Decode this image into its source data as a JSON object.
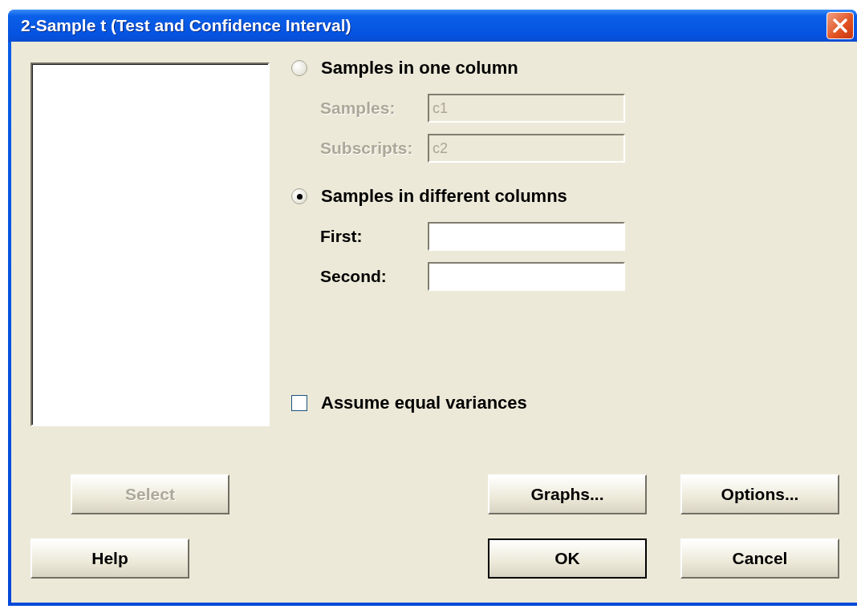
{
  "window": {
    "title": "2-Sample t (Test and Confidence Interval)"
  },
  "modes": [
    {
      "label": "Samples in one column",
      "selected": false,
      "fields": [
        {
          "label": "Samples:",
          "value": "c1",
          "disabled": true
        },
        {
          "label": "Subscripts:",
          "value": "c2",
          "disabled": true
        }
      ]
    },
    {
      "label": "Samples in different columns",
      "selected": true,
      "fields": [
        {
          "label": "First:",
          "disabled": false
        },
        {
          "label": "Second:",
          "disabled": false
        }
      ]
    }
  ],
  "equal_variances": {
    "label": "Assume equal variances",
    "checked": false
  },
  "button_rows": [
    {
      "left": [
        {
          "label": "Select",
          "disabled": true,
          "default": false
        }
      ],
      "right": [
        {
          "label": "Graphs...",
          "disabled": false,
          "default": false
        },
        {
          "label": "Options...",
          "disabled": false,
          "default": false
        }
      ]
    },
    {
      "left": [
        {
          "label": "Help",
          "disabled": false,
          "default": false
        }
      ],
      "right": [
        {
          "label": "OK",
          "disabled": false,
          "default": true
        },
        {
          "label": "Cancel",
          "disabled": false,
          "default": false
        }
      ]
    }
  ]
}
